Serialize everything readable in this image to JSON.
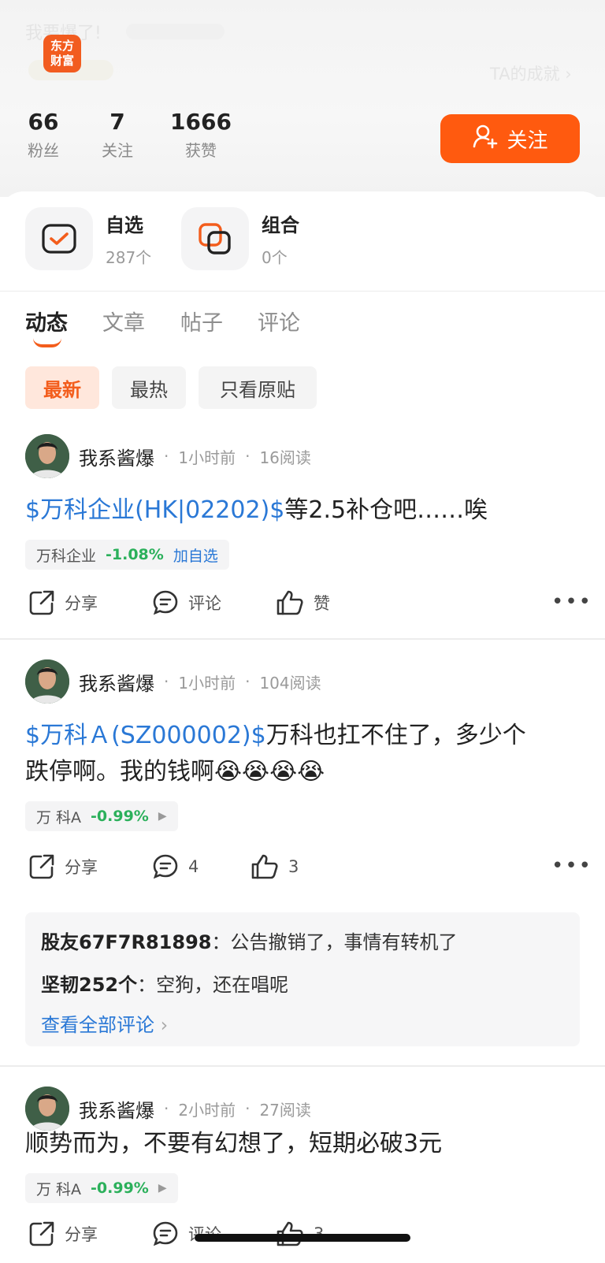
{
  "header": {
    "nickname_faded": "我要爆了!",
    "ta_achievement_faded": "TA的成就",
    "logo_text_line1": "东方",
    "logo_text_line2": "财富",
    "stats": [
      {
        "value": "66",
        "label": "粉丝"
      },
      {
        "value": "7",
        "label": "关注"
      },
      {
        "value": "1666",
        "label": "获赞"
      }
    ],
    "follow_label": "关注"
  },
  "quick": [
    {
      "title": "自选",
      "sub": "287个"
    },
    {
      "title": "组合",
      "sub": "0个"
    }
  ],
  "tabs": [
    "动态",
    "文章",
    "帖子",
    "评论"
  ],
  "filters": [
    "最新",
    "最热",
    "只看原贴"
  ],
  "posts": [
    {
      "author": "我系酱爆",
      "time": "1小时前",
      "reads": "16阅读",
      "link_text": "$万科企业(HK|02202)$",
      "body_line1": "等2.5补仓吧……唉",
      "stock": {
        "name": "万科企业",
        "change": "-1.08%",
        "extra": "加自选"
      },
      "share": "分享",
      "comment": "评论",
      "like": "赞"
    },
    {
      "author": "我系酱爆",
      "time": "1小时前",
      "reads": "104阅读",
      "link_text": "$万科Ａ(SZ000002)$",
      "body_line1": "万科也扛不住了，多少个",
      "body_line2": "跌停啊。我的钱啊😭😭😭😭",
      "stock": {
        "name": "万 科A",
        "change": "-0.99%"
      },
      "share": "分享",
      "comment": "4",
      "like": "3",
      "comments": [
        {
          "user": "股友67F7R81898",
          "text": "公告撤销了，事情有转机了"
        },
        {
          "user": "坚韧252个",
          "text": "空狗，还在唱呢"
        }
      ],
      "view_all": "查看全部评论"
    },
    {
      "author": "我系酱爆",
      "time": "2小时前",
      "reads": "27阅读",
      "body_line1": "顺势而为，不要有幻想了，短期必破3元",
      "stock": {
        "name": "万 科A",
        "change": "-0.99%"
      },
      "share": "分享",
      "comment": "评论",
      "like": "3"
    }
  ],
  "colors": {
    "accent": "#ff5a0f",
    "link": "#2a78d6",
    "down": "#2bb05b"
  }
}
